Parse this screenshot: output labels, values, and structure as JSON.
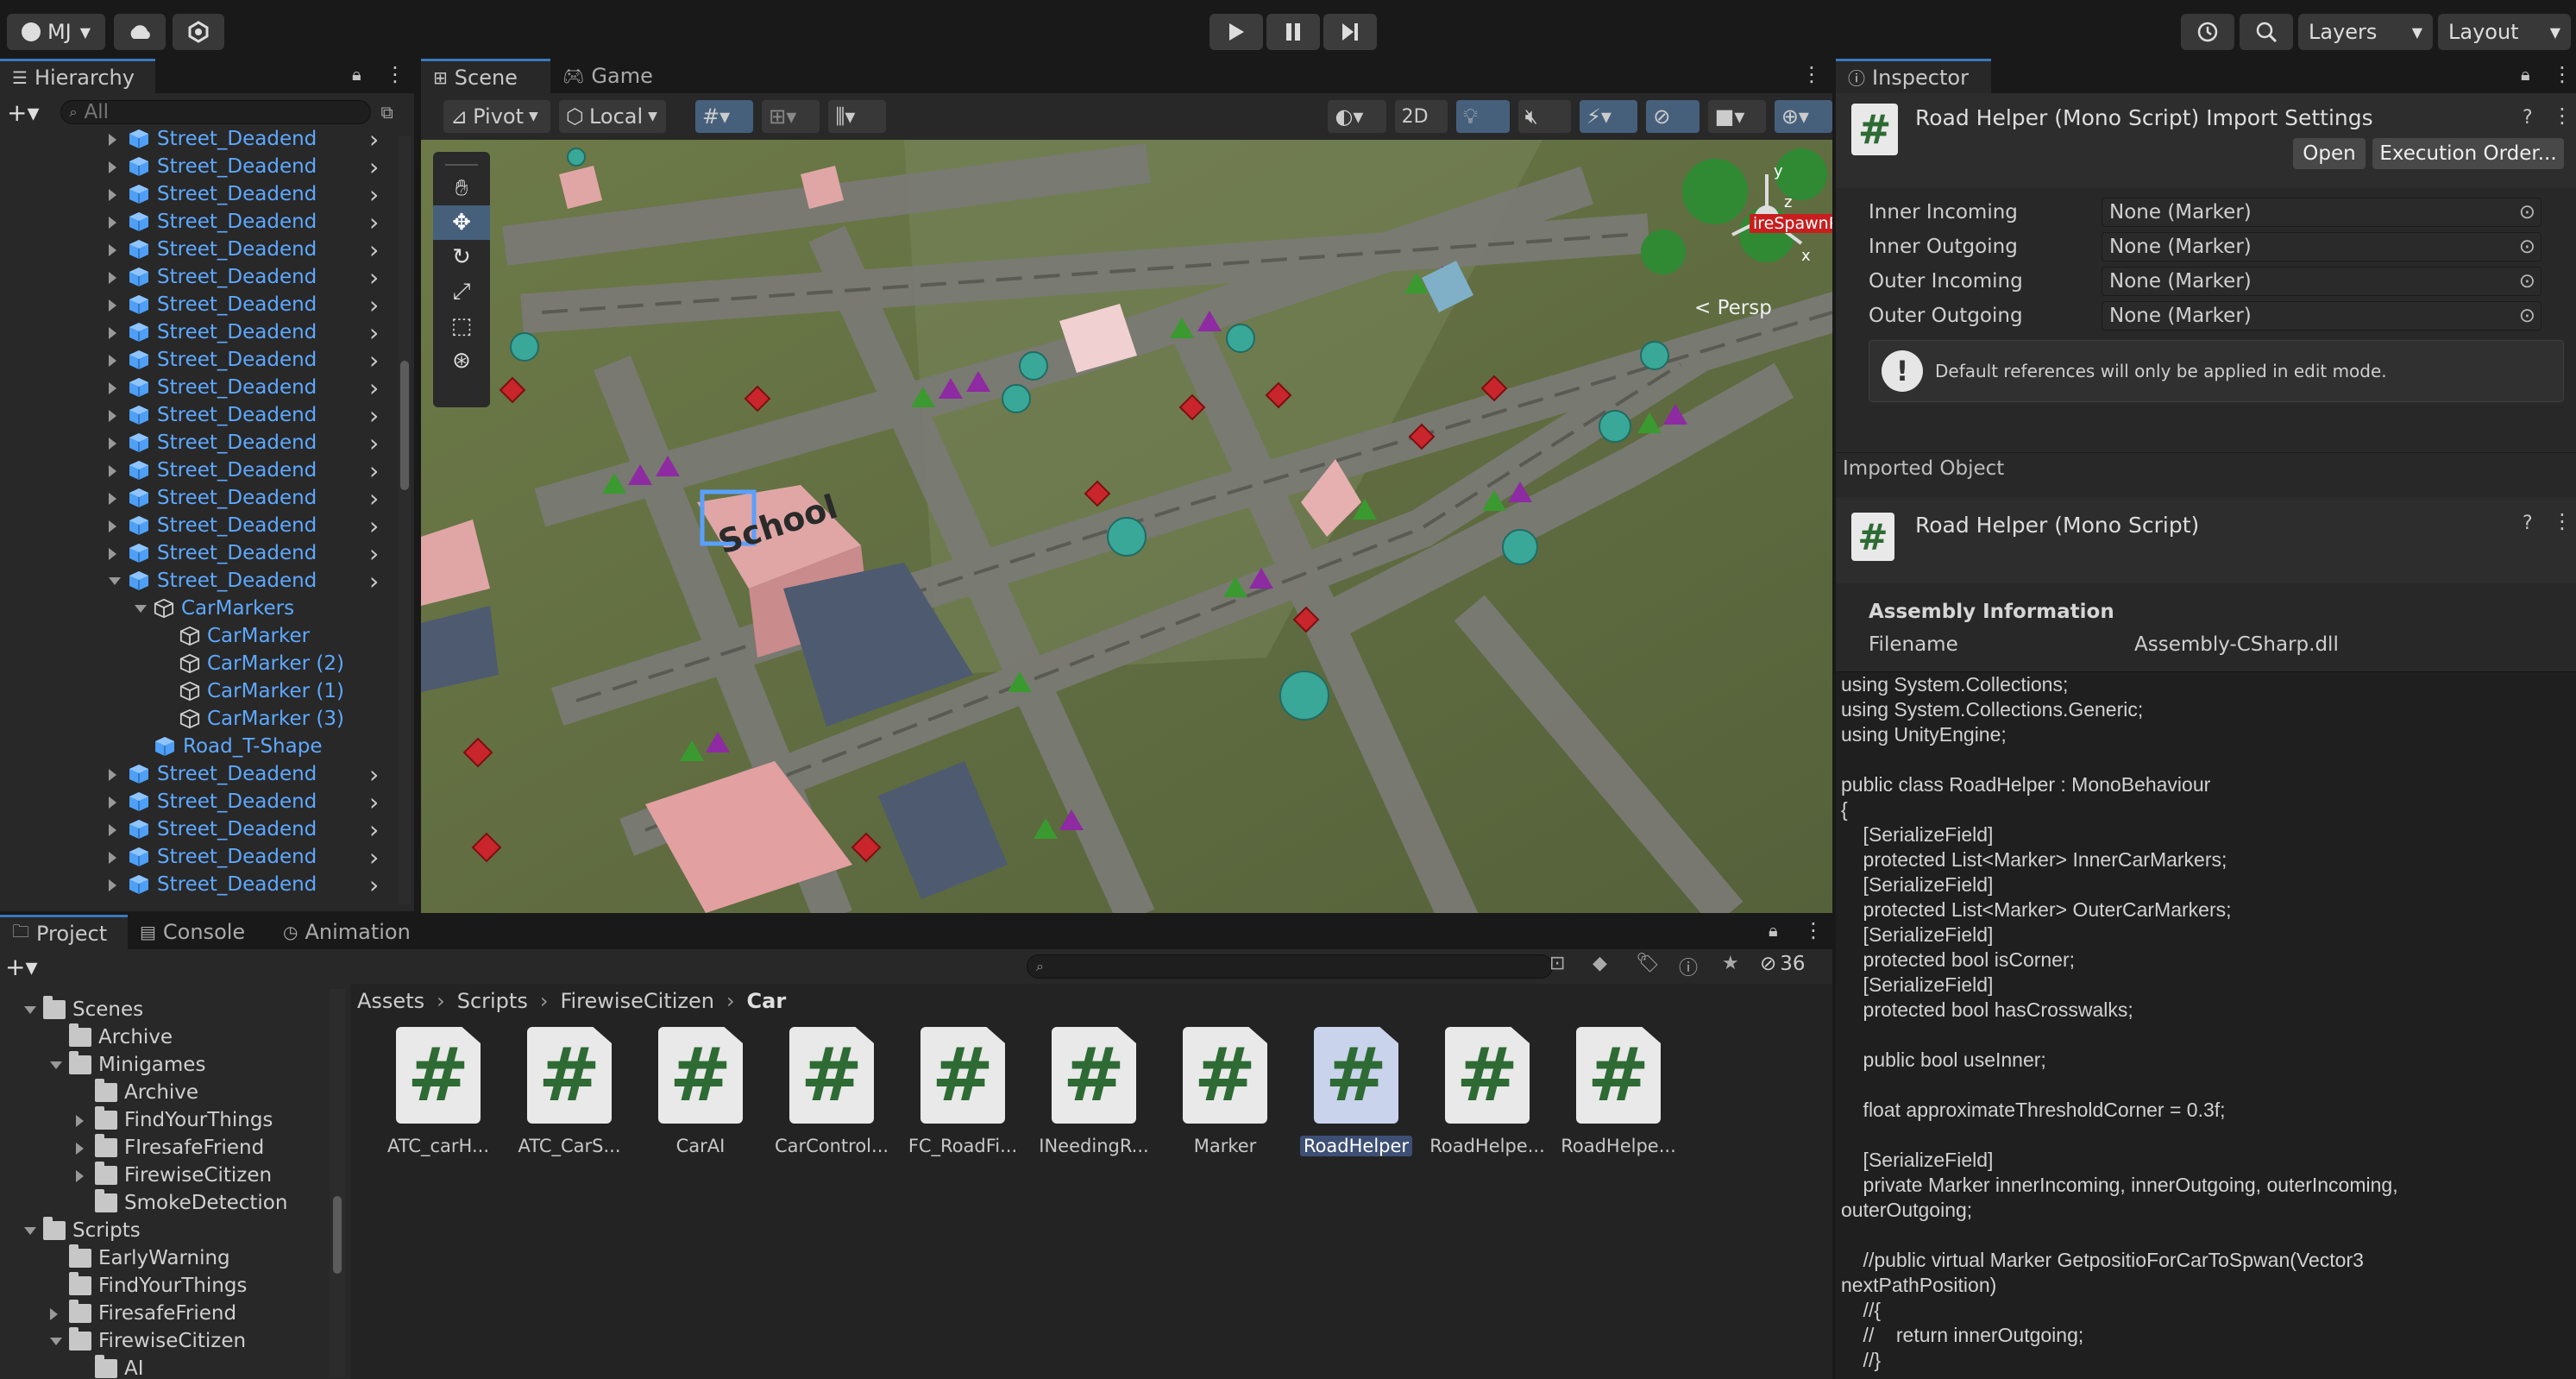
{
  "topbar": {
    "account": "MJ",
    "layers": "Layers",
    "layout": "Layout"
  },
  "hierarchy": {
    "tab": "Hierarchy",
    "search_placeholder": "All",
    "rows": [
      {
        "label": "Street_Deadend",
        "indent": 0,
        "arrow": "right",
        "icon": "prefab",
        "chev": true
      },
      {
        "label": "Street_Deadend",
        "indent": 0,
        "arrow": "right",
        "icon": "prefab",
        "chev": true
      },
      {
        "label": "Street_Deadend",
        "indent": 0,
        "arrow": "right",
        "icon": "prefab",
        "chev": true
      },
      {
        "label": "Street_Deadend",
        "indent": 0,
        "arrow": "right",
        "icon": "prefab",
        "chev": true
      },
      {
        "label": "Street_Deadend",
        "indent": 0,
        "arrow": "right",
        "icon": "prefab",
        "chev": true
      },
      {
        "label": "Street_Deadend",
        "indent": 0,
        "arrow": "right",
        "icon": "prefab",
        "chev": true
      },
      {
        "label": "Street_Deadend",
        "indent": 0,
        "arrow": "right",
        "icon": "prefab",
        "chev": true
      },
      {
        "label": "Street_Deadend",
        "indent": 0,
        "arrow": "right",
        "icon": "prefab",
        "chev": true
      },
      {
        "label": "Street_Deadend",
        "indent": 0,
        "arrow": "right",
        "icon": "prefab",
        "chev": true
      },
      {
        "label": "Street_Deadend",
        "indent": 0,
        "arrow": "right",
        "icon": "prefab",
        "chev": true
      },
      {
        "label": "Street_Deadend",
        "indent": 0,
        "arrow": "right",
        "icon": "prefab",
        "chev": true
      },
      {
        "label": "Street_Deadend",
        "indent": 0,
        "arrow": "right",
        "icon": "prefab",
        "chev": true
      },
      {
        "label": "Street_Deadend",
        "indent": 0,
        "arrow": "right",
        "icon": "prefab",
        "chev": true
      },
      {
        "label": "Street_Deadend",
        "indent": 0,
        "arrow": "right",
        "icon": "prefab",
        "chev": true
      },
      {
        "label": "Street_Deadend",
        "indent": 0,
        "arrow": "right",
        "icon": "prefab",
        "chev": true
      },
      {
        "label": "Street_Deadend",
        "indent": 0,
        "arrow": "right",
        "icon": "prefab",
        "chev": true
      },
      {
        "label": "Street_Deadend",
        "indent": 0,
        "arrow": "down",
        "icon": "prefab",
        "chev": true
      },
      {
        "label": "CarMarkers",
        "indent": 1,
        "arrow": "down",
        "icon": "object",
        "chev": false
      },
      {
        "label": "CarMarker",
        "indent": 2,
        "arrow": "none",
        "icon": "object",
        "chev": false
      },
      {
        "label": "CarMarker (2)",
        "indent": 2,
        "arrow": "none",
        "icon": "object",
        "chev": false
      },
      {
        "label": "CarMarker (1)",
        "indent": 2,
        "arrow": "none",
        "icon": "object",
        "chev": false
      },
      {
        "label": "CarMarker (3)",
        "indent": 2,
        "arrow": "none",
        "icon": "object",
        "chev": false
      },
      {
        "label": "Road_T-Shape",
        "indent": 1,
        "arrow": "none",
        "icon": "prefab",
        "chev": false
      },
      {
        "label": "Street_Deadend",
        "indent": 0,
        "arrow": "right",
        "icon": "prefab",
        "chev": true
      },
      {
        "label": "Street_Deadend",
        "indent": 0,
        "arrow": "right",
        "icon": "prefab",
        "chev": true
      },
      {
        "label": "Street_Deadend",
        "indent": 0,
        "arrow": "right",
        "icon": "prefab",
        "chev": true
      },
      {
        "label": "Street_Deadend",
        "indent": 0,
        "arrow": "right",
        "icon": "prefab",
        "chev": true
      },
      {
        "label": "Street_Deadend",
        "indent": 0,
        "arrow": "right",
        "icon": "prefab",
        "chev": true
      }
    ]
  },
  "scene": {
    "tabs": [
      "Scene",
      "Game"
    ],
    "pivot": "Pivot",
    "local": "Local",
    "twod": "2D",
    "persp": "< Persp",
    "spawn_label": "ireSpawnP",
    "school_sign": "School"
  },
  "inspector": {
    "tab": "Inspector",
    "title": "Road Helper (Mono Script) Import Settings",
    "open_btn": "Open",
    "exec_btn": "Execution Order...",
    "fields": [
      {
        "label": "Inner Incoming",
        "value": "None (Marker)"
      },
      {
        "label": "Inner Outgoing",
        "value": "None (Marker)"
      },
      {
        "label": "Outer Incoming",
        "value": "None (Marker)"
      },
      {
        "label": "Outer Outgoing",
        "value": "None (Marker)"
      }
    ],
    "warning": "Default references will only be applied in edit mode.",
    "imported_object": "Imported Object",
    "script_name": "Road Helper (Mono Script)",
    "assembly_header": "Assembly Information",
    "filename_label": "Filename",
    "filename_value": "Assembly-CSharp.dll",
    "code": "using System.Collections;\nusing System.Collections.Generic;\nusing UnityEngine;\n\npublic class RoadHelper : MonoBehaviour\n{\n    [SerializeField]\n    protected List<Marker> InnerCarMarkers;\n    [SerializeField]\n    protected List<Marker> OuterCarMarkers;\n    [SerializeField]\n    protected bool isCorner;\n    [SerializeField]\n    protected bool hasCrosswalks;\n\n    public bool useInner;\n\n    float approximateThresholdCorner = 0.3f;\n\n    [SerializeField]\n    private Marker innerIncoming, innerOutgoing, outerIncoming,\nouterOutgoing;\n\n    //public virtual Marker GetpositioForCarToSpwan(Vector3\nnextPathPosition)\n    //{\n    //    return innerOutgoing;\n    //}"
  },
  "project": {
    "tabs": [
      "Project",
      "Console",
      "Animation"
    ],
    "hidden_count": "36",
    "breadcrumb": [
      "Assets",
      "Scripts",
      "FirewiseCitizen",
      "Car"
    ],
    "tree": [
      {
        "label": "Scenes",
        "indent": 0,
        "arrow": "down"
      },
      {
        "label": "Archive",
        "indent": 1,
        "arrow": "none"
      },
      {
        "label": "Minigames",
        "indent": 1,
        "arrow": "down"
      },
      {
        "label": "Archive",
        "indent": 2,
        "arrow": "none"
      },
      {
        "label": "FindYourThings",
        "indent": 2,
        "arrow": "right"
      },
      {
        "label": "FIresafeFriend",
        "indent": 2,
        "arrow": "right"
      },
      {
        "label": "FirewiseCitizen",
        "indent": 2,
        "arrow": "right"
      },
      {
        "label": "SmokeDetection",
        "indent": 2,
        "arrow": "none"
      },
      {
        "label": "Scripts",
        "indent": 0,
        "arrow": "down"
      },
      {
        "label": "EarlyWarning",
        "indent": 1,
        "arrow": "none"
      },
      {
        "label": "FindYourThings",
        "indent": 1,
        "arrow": "none"
      },
      {
        "label": "FiresafeFriend",
        "indent": 1,
        "arrow": "right"
      },
      {
        "label": "FirewiseCitizen",
        "indent": 1,
        "arrow": "down"
      },
      {
        "label": "AI",
        "indent": 2,
        "arrow": "none"
      }
    ],
    "assets": [
      {
        "label": "ATC_carH...",
        "selected": false
      },
      {
        "label": "ATC_CarS...",
        "selected": false
      },
      {
        "label": "CarAI",
        "selected": false
      },
      {
        "label": "CarControl...",
        "selected": false
      },
      {
        "label": "FC_RoadFi...",
        "selected": false
      },
      {
        "label": "INeedingR...",
        "selected": false
      },
      {
        "label": "Marker",
        "selected": false
      },
      {
        "label": "RoadHelper",
        "selected": true
      },
      {
        "label": "RoadHelpe...",
        "selected": false
      },
      {
        "label": "RoadHelpe...",
        "selected": false
      }
    ]
  }
}
